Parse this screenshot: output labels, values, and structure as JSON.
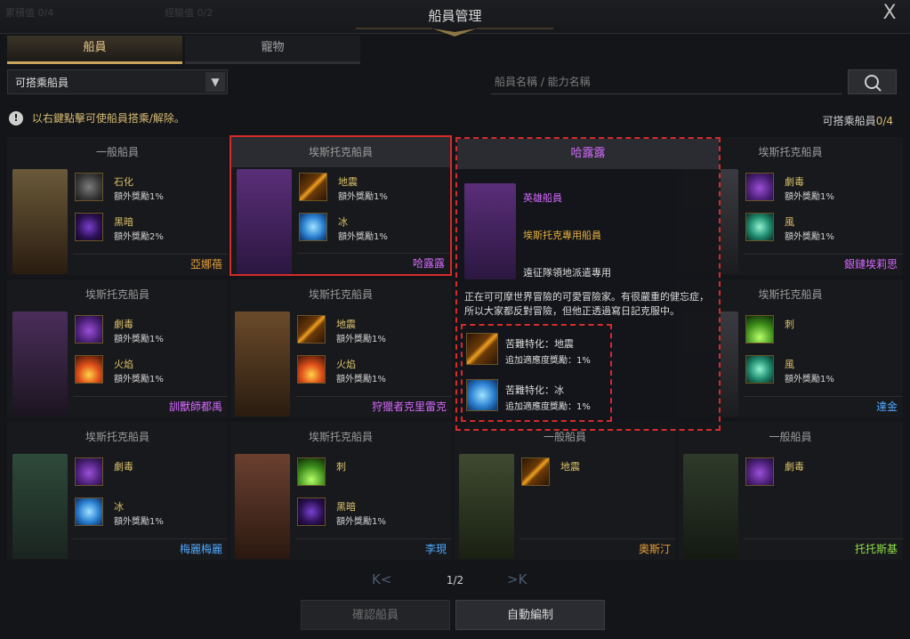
{
  "window": {
    "title": "船員管理",
    "close_label": "X",
    "ghost_left": "累積值 0/4",
    "ghost_mid": "經驗值 0/2"
  },
  "tabs": [
    {
      "label": "船員"
    },
    {
      "label": "寵物"
    }
  ],
  "filter": {
    "selected": "可搭乘船員"
  },
  "search": {
    "placeholder": "船員名稱 / 能力名稱"
  },
  "info": {
    "text": "以右鍵點擊可使船員搭乘/解除。"
  },
  "count": {
    "label": "可搭乘船員",
    "value": "0/4"
  },
  "cards": [
    {
      "header": "一般船員",
      "name": "亞娜蓓",
      "name_color": "#e8a13a",
      "skills": [
        {
          "icon": "stone",
          "name": "石化",
          "bonus": "額外獎勵1%"
        },
        {
          "icon": "dark",
          "name": "黑暗",
          "bonus": "額外獎勵2%"
        }
      ]
    },
    {
      "header": "埃斯托克船員",
      "name": "哈露露",
      "name_color": "#d569ff",
      "skills": [
        {
          "icon": "earth",
          "name": "地震",
          "bonus": "額外獎勵1%"
        },
        {
          "icon": "ice",
          "name": "冰",
          "bonus": "額外獎勵1%"
        }
      ]
    },
    {
      "header": "埃斯托克船員",
      "name": "銀鏈埃莉思",
      "name_color": "#d569ff",
      "skills": [
        {
          "icon": "crit",
          "name": "劇毒",
          "bonus": "額外獎勵1%"
        },
        {
          "icon": "wind",
          "name": "風",
          "bonus": "額外獎勵1%"
        }
      ]
    },
    {
      "header": "埃斯托克船員",
      "name": "訓獸師都禹",
      "name_color": "#d569ff",
      "skills": [
        {
          "icon": "crit",
          "name": "劇毒",
          "bonus": "額外獎勵1%"
        },
        {
          "icon": "fire",
          "name": "火焰",
          "bonus": "額外獎勵1%"
        }
      ]
    },
    {
      "header": "埃斯托克船員",
      "name": "狩獵者克里雷克",
      "name_color": "#d569ff",
      "skills": [
        {
          "icon": "earth",
          "name": "地震",
          "bonus": "額外獎勵1%"
        },
        {
          "icon": "fire",
          "name": "火焰",
          "bonus": "額外獎勵1%"
        }
      ]
    },
    {
      "header": "埃斯托克船員",
      "name": "達金",
      "name_color": "#4fa8ff",
      "skills": [
        {
          "icon": "thorn",
          "name": "刺",
          "bonus": ""
        },
        {
          "icon": "wind",
          "name": "風",
          "bonus": "額外獎勵1%"
        }
      ]
    },
    {
      "header": "埃斯托克船員",
      "name": "梅麗梅麗",
      "name_color": "#4fa8ff",
      "skills": [
        {
          "icon": "crit",
          "name": "劇毒",
          "bonus": ""
        },
        {
          "icon": "ice",
          "name": "冰",
          "bonus": "額外獎勵1%"
        }
      ]
    },
    {
      "header": "埃斯托克船員",
      "name": "李現",
      "name_color": "#4fa8ff",
      "skills": [
        {
          "icon": "thorn",
          "name": "刺",
          "bonus": ""
        },
        {
          "icon": "dark",
          "name": "黑暗",
          "bonus": "額外獎勵1%"
        }
      ]
    },
    {
      "header": "一般船員",
      "name": "奧斯汀",
      "name_color": "#e8a13a",
      "skills": [
        {
          "icon": "earth",
          "name": "地震",
          "bonus": ""
        }
      ]
    },
    {
      "header": "一般船員",
      "name": "托托斯基",
      "name_color": "#8fe04a",
      "skills": [
        {
          "icon": "crit",
          "name": "劇毒",
          "bonus": ""
        }
      ]
    }
  ],
  "tooltip": {
    "title": "哈露露",
    "role": "英雄船員",
    "exclusive": "埃斯托克專用船員",
    "dispatch": "遠征隊領地派遣專用",
    "desc": "正在可可摩世界冒險的可愛冒險家。有很嚴重的健忘症，所以大家都反對冒險，但他正透過寫日記克服中。",
    "skills": [
      {
        "icon": "earth",
        "name": "苦難特化：地震",
        "bonus": "追加適應度獎勵：1%"
      },
      {
        "icon": "ice",
        "name": "苦難特化：冰",
        "bonus": "追加適應度獎勵：1%"
      }
    ]
  },
  "pager": {
    "first": "K<",
    "last": ">K",
    "page": "1/2"
  },
  "buttons": {
    "confirm": "確認船員",
    "auto": "自動編制"
  }
}
